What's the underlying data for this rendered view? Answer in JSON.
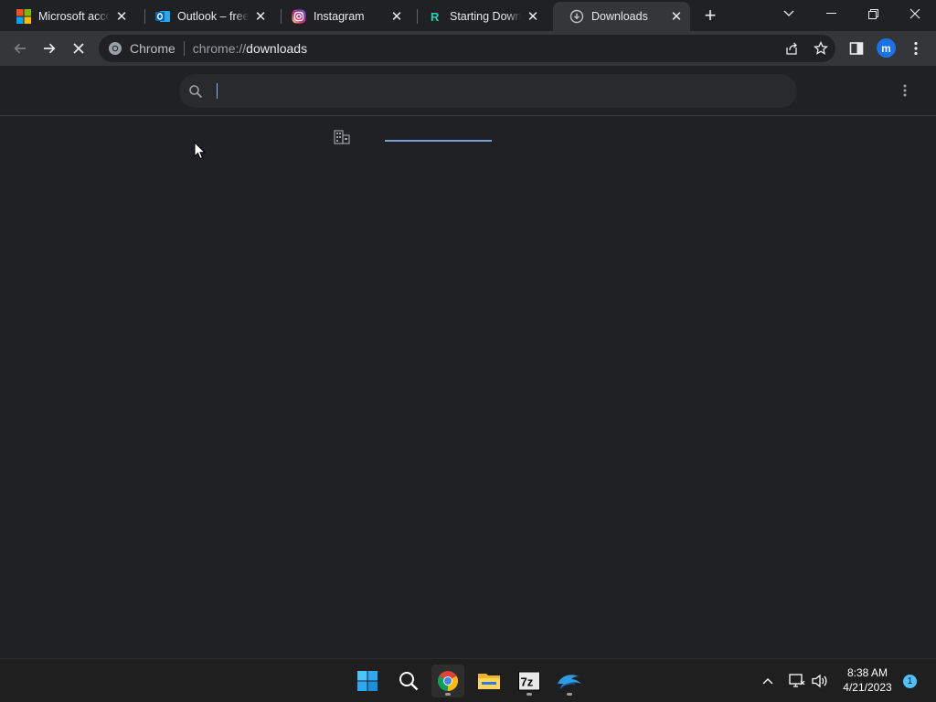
{
  "browser": {
    "tabs": [
      {
        "label": "Microsoft account",
        "icon": "microsoft-logo-icon",
        "active": false
      },
      {
        "label": "Outlook – free personal email",
        "icon": "outlook-icon",
        "active": false
      },
      {
        "label": "Instagram",
        "icon": "instagram-icon",
        "active": false
      },
      {
        "label": "Starting Download",
        "icon": "r-logo-icon",
        "active": false
      },
      {
        "label": "Downloads",
        "icon": "download-icon",
        "active": true
      }
    ],
    "new_tab_label": "+",
    "close_glyph": "✕",
    "omnibox": {
      "site_label": "Chrome",
      "url_scheme": "chrome://",
      "url_host": "downloads"
    },
    "profile_initial": "m"
  },
  "downloads_page": {
    "search_value": "",
    "search_placeholder": ""
  },
  "taskbar": {
    "apps": [
      "start-icon",
      "search-icon",
      "chrome-icon",
      "file-explorer-icon",
      "7zip-icon",
      "dolphin-icon"
    ],
    "sevenzip_label": "7z",
    "clock_time": "8:38 AM",
    "clock_date": "4/21/2023",
    "notification_count": "1"
  },
  "colors": {
    "background": "#202124",
    "toolbar": "#35363a",
    "accent": "#8ab4f8",
    "avatar": "#1a73e8",
    "taskbar": "#1f1f1f"
  }
}
